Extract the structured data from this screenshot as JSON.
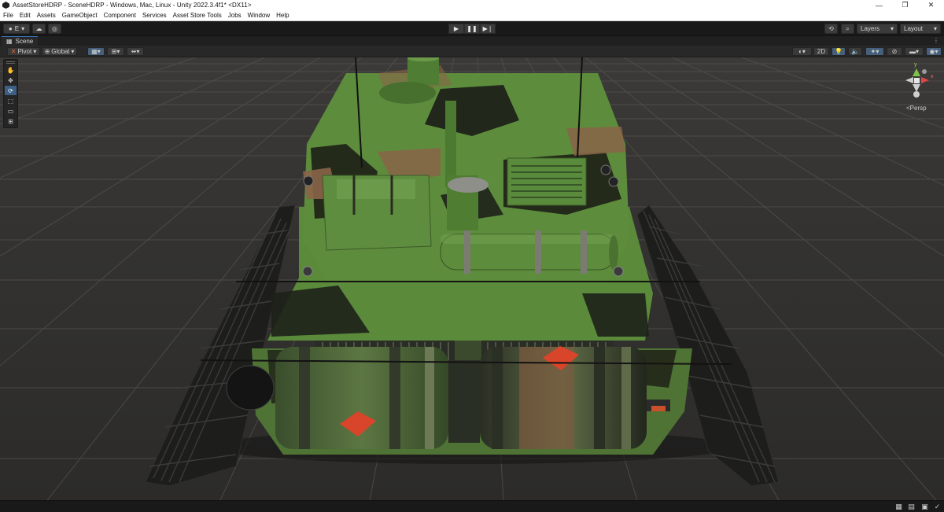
{
  "window": {
    "title": "AssetStoreHDRP - SceneHDRP - Windows, Mac, Linux - Unity 2022.3.4f1* <DX11>",
    "controls": {
      "minimize": "—",
      "restore": "❐",
      "close": "✕"
    }
  },
  "menu": [
    "File",
    "Edit",
    "Assets",
    "GameObject",
    "Component",
    "Services",
    "Asset Store Tools",
    "Jobs",
    "Window",
    "Help"
  ],
  "toolbar": {
    "account_label": "E",
    "account_icon": "account-icon",
    "cloud_icon": "cloud-icon",
    "collab_icon": "collab-icon",
    "play": "▶",
    "pause": "❚❚",
    "step": "▶❘",
    "history_icon": "history-icon",
    "search_icon": "search-icon",
    "layers_label": "Layers",
    "layout_label": "Layout"
  },
  "scene_tab": {
    "label": "Scene",
    "menu": "⋮"
  },
  "scene_toolbar": {
    "pivot_label": "Pivot",
    "global_label": "Global",
    "toggle_2d": "2D"
  },
  "tools": [
    "✋",
    "✥",
    "⟳",
    "⬚",
    "▭",
    "⊞"
  ],
  "gizmo": {
    "axis_y": "y",
    "axis_x": "x",
    "projection_label": "Persp"
  },
  "colors": {
    "camo_green": "#5d8a3c",
    "camo_dark": "#1e2218",
    "camo_brown": "#8a6448",
    "hazard_orange": "#d8452a",
    "accent_blue": "#3d5f85"
  }
}
